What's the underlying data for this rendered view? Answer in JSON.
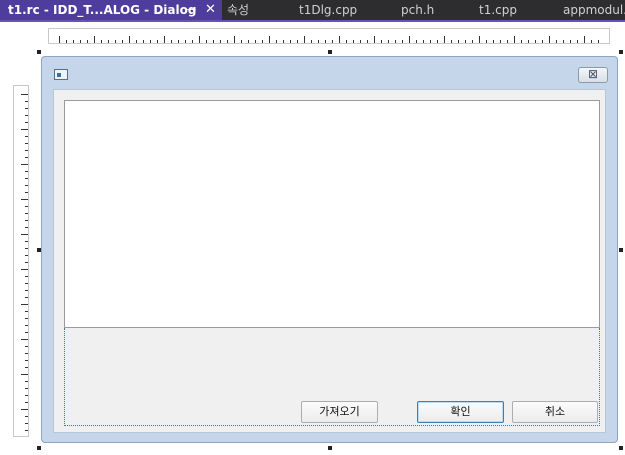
{
  "tabs": [
    {
      "label": "t1.rc - IDD_T...ALOG - Dialog",
      "active": true,
      "pin": "⊸",
      "close": "✕"
    },
    {
      "label": "속성",
      "active": false
    },
    {
      "label": "t1Dlg.cpp",
      "active": false
    },
    {
      "label": "pch.h",
      "active": false
    },
    {
      "label": "t1.cpp",
      "active": false
    },
    {
      "label": "appmodul.c",
      "active": false
    }
  ],
  "dialog": {
    "close_glyph": "⊠",
    "buttons": {
      "import": "가져오기",
      "ok": "확인",
      "cancel": "취소"
    }
  },
  "colors": {
    "tab_bar": "#2d2d30",
    "active_tab": "#4f3d9e",
    "accent": "#6b4fbb",
    "dialog_frame": "#c5d6ea",
    "dialog_client": "#f0f0f0"
  },
  "icons": [
    "pin-icon",
    "close-icon",
    "dialog-app-icon",
    "dialog-close-icon"
  ]
}
